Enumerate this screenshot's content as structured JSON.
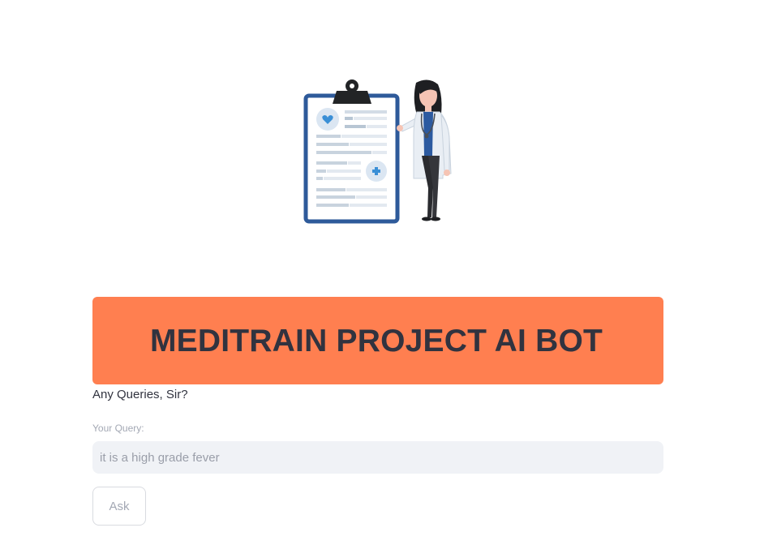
{
  "hero": {
    "image_name": "doctor-with-clipboard-illustration",
    "colors": {
      "clipboard_border": "#2e5a9a",
      "clipboard_clip": "#222426",
      "icon_circle": "#dbe6f2",
      "icon_accent": "#3a8fd6",
      "text_lines": "#d3dce6",
      "coat": "#e9eef4",
      "shirt": "#2c5aa0",
      "hair": "#1e1f22",
      "skin": "#f6c4b4"
    }
  },
  "banner": {
    "title": "MEDITRAIN PROJECT AI BOT",
    "background": "#ff7f50"
  },
  "prompt": {
    "text": "Any Queries, Sir?"
  },
  "query": {
    "label": "Your Query:",
    "value": "it is a high grade fever"
  },
  "actions": {
    "ask_label": "Ask"
  }
}
